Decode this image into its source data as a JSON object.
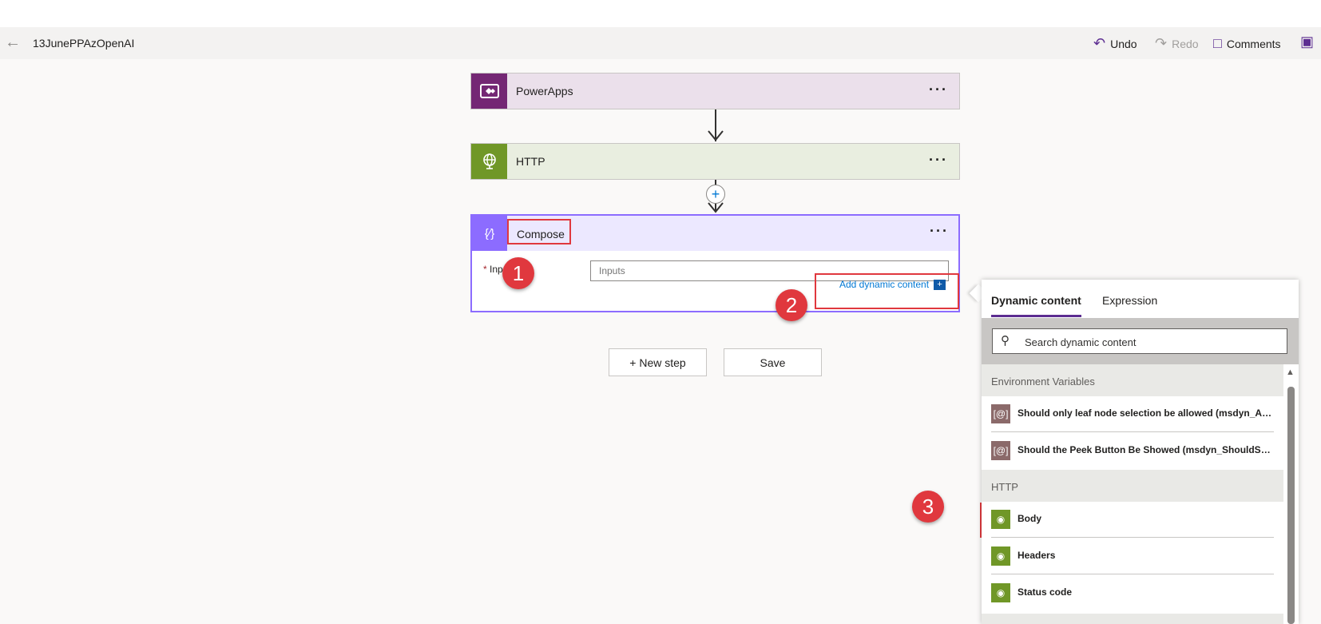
{
  "header": {
    "flow_name": "13JunePPAzOpenAI",
    "undo_label": "Undo",
    "redo_label": "Redo",
    "comments_label": "Comments"
  },
  "steps": {
    "powerapps_label": "PowerApps",
    "http_label": "HTTP",
    "compose_label": "Compose",
    "inputs_field_label": "Inp",
    "inputs_required_mark": "*",
    "inputs_placeholder": "Inputs",
    "add_dynamic_label": "Add dynamic content"
  },
  "actions": {
    "new_step_label": "+ New step",
    "save_label": "Save"
  },
  "annotations": {
    "badge1": "1",
    "badge2": "2",
    "badge3": "3"
  },
  "dynamic_panel": {
    "tab_dynamic": "Dynamic content",
    "tab_expression": "Expression",
    "search_placeholder": "Search dynamic content",
    "sections": [
      {
        "title": "Environment Variables",
        "items": [
          "Should only leaf node selection be allowed (msdyn_All...",
          "Should the Peek Button Be Showed (msdyn_ShouldSho..."
        ]
      },
      {
        "title": "HTTP",
        "items": [
          "Body",
          "Headers",
          "Status code"
        ]
      }
    ]
  },
  "colors": {
    "powerapps": "#742774",
    "http": "#709727",
    "compose": "#8c6cff",
    "env_var": "#8b6a6a",
    "accent": "#5c2d91",
    "annotation": "#e0383e"
  }
}
